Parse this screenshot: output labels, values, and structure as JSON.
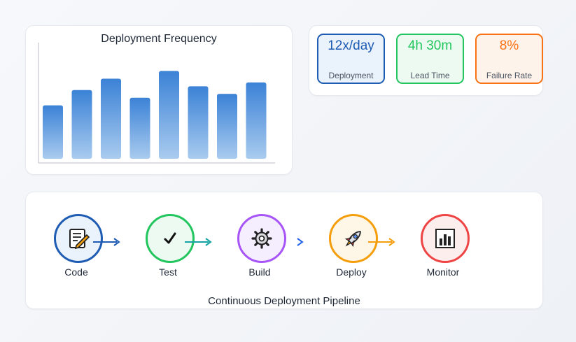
{
  "chart": {
    "title": "Deployment Frequency"
  },
  "chart_data": {
    "type": "bar",
    "title": "Deployment Frequency",
    "xlabel": "",
    "ylabel": "",
    "values": [
      56,
      72,
      84,
      64,
      92,
      76,
      68,
      80
    ],
    "ylim": [
      0,
      110
    ],
    "grid": false,
    "color": "#3b82d6"
  },
  "metrics": [
    {
      "value": "12x/day",
      "label": "Deployment",
      "color": "#1e5cb3"
    },
    {
      "value": "4h 30m",
      "label": "Lead Time",
      "color": "#22c55e"
    },
    {
      "value": "8%",
      "label": "Failure Rate",
      "color": "#f97316"
    }
  ],
  "pipeline": {
    "caption": "Continuous Deployment Pipeline",
    "stages": [
      {
        "label": "Code",
        "icon": "memo-icon",
        "color": "#1e5cb3",
        "fill": "#eaf2fc"
      },
      {
        "label": "Test",
        "icon": "check-icon",
        "color": "#22c55e",
        "fill": "#ecfaf1"
      },
      {
        "label": "Build",
        "icon": "gear-icon",
        "color": "#a855f7",
        "fill": "#f5eefe"
      },
      {
        "label": "Deploy",
        "icon": "rocket-icon",
        "color": "#f59e0b",
        "fill": "#fef6e7"
      },
      {
        "label": "Monitor",
        "icon": "bar-chart-icon",
        "color": "#ef4444",
        "fill": "#fdeeee"
      }
    ]
  }
}
